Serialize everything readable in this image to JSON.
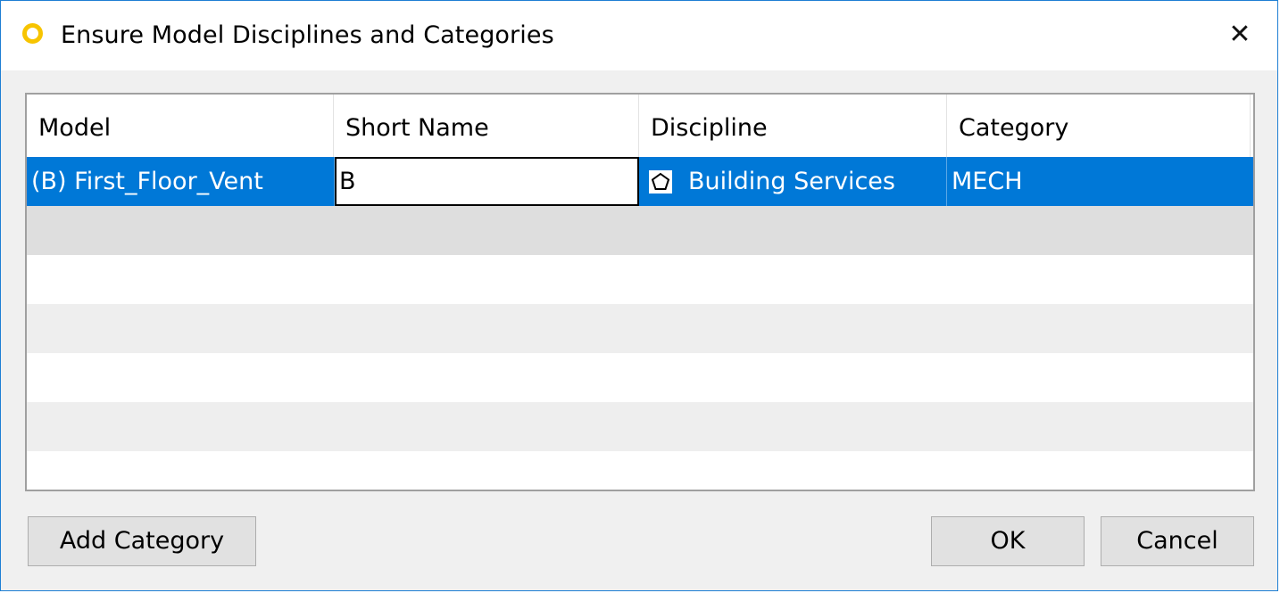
{
  "window": {
    "title": "Ensure Model Disciplines and Categories",
    "close_glyph": "✕"
  },
  "grid": {
    "columns": [
      "Model",
      "Short Name",
      "Discipline",
      "Category"
    ],
    "rows": [
      {
        "model": "(B) First_Floor_Vent",
        "short_name": "B",
        "discipline": "Building Services",
        "discipline_icon": "pentagon-icon",
        "category": "MECH",
        "selected": true
      }
    ]
  },
  "buttons": {
    "add_category": "Add Category",
    "ok": "OK",
    "cancel": "Cancel"
  },
  "colors": {
    "selection": "#0078d7",
    "accent_border": "#1e7fd4",
    "app_icon": "#f7c400"
  }
}
